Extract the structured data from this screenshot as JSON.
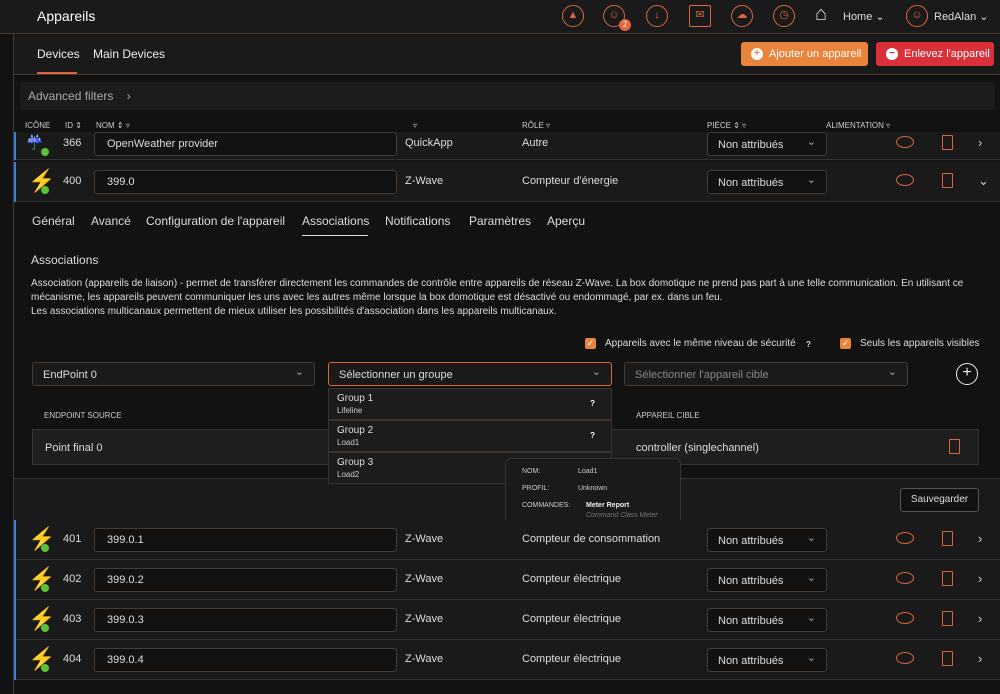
{
  "header": {
    "title": "Appareils",
    "home": "Home",
    "user": "RedAlan",
    "notification_count": "2",
    "icons": [
      "alarm-icon",
      "users-icon",
      "download-icon",
      "mail-icon",
      "weather-icon",
      "clock-icon",
      "home-icon",
      "user-icon"
    ]
  },
  "tabs": [
    {
      "label": "Devices",
      "active": true
    },
    {
      "label": "Main Devices"
    }
  ],
  "actions": {
    "add": "Ajouter un appareil",
    "remove": "Enlevez l'appareil",
    "add_color": "#e8843c",
    "remove_color": "#d9303a"
  },
  "filters": {
    "label": "Advanced filters"
  },
  "columns": {
    "icon": "ICÔNE",
    "id": "ID",
    "name": "NOM",
    "role": "RÔLE",
    "room": "PIÈCE",
    "power": "ALIMENTATION"
  },
  "rows": [
    {
      "id": "366",
      "name": "OpenWeather provider",
      "type": "QuickApp",
      "role": "Autre",
      "room": "Non attribués"
    },
    {
      "id": "400",
      "name": "399.0",
      "type": "Z-Wave",
      "role": "Compteur d'énergie",
      "room": "Non attribués"
    },
    {
      "id": "401",
      "name": "399.0.1",
      "type": "Z-Wave",
      "role": "Compteur de consommation",
      "room": "Non attribués"
    },
    {
      "id": "402",
      "name": "399.0.2",
      "type": "Z-Wave",
      "role": "Compteur électrique",
      "room": "Non attribués"
    },
    {
      "id": "403",
      "name": "399.0.3",
      "type": "Z-Wave",
      "role": "Compteur électrique",
      "room": "Non attribués"
    },
    {
      "id": "404",
      "name": "399.0.4",
      "type": "Z-Wave",
      "role": "Compteur électrique",
      "room": "Non attribués"
    }
  ],
  "detail": {
    "tabs": [
      "Général",
      "Avancé",
      "Configuration de l'appareil",
      "Associations",
      "Notifications",
      "Paramètres",
      "Aperçu"
    ],
    "active_tab": "Associations",
    "heading": "Associations",
    "desc1": "Association (appareils de liaison) - permet de transférer directement les commandes de contrôle entre appareils de réseau Z-Wave. La box domotique ne prend pas part à une telle communication. En utilisant ce",
    "desc2": "mécanisme, les appareils peuvent communiquer les uns avec les autres même lorsque la box domotique est désactivé ou endommagé, par ex. dans un feu.",
    "desc3": "Les associations multicanaux permettent de mieux utiliser les possibilités d'association dans les appareils multicanaux.",
    "check_security": "Appareils avec le même niveau de sécurité",
    "check_security_help": "?",
    "check_visible": "Seuls les appareils visibles",
    "endpoint": "EndPoint 0",
    "group_placeholder": "Sélectionner un groupe",
    "target_placeholder": "Sélectionner l'appareil cible",
    "col_source": "ENDPOINT SOURCE",
    "col_target": "APPAREIL CIBLE",
    "assoc_source": "Point final 0",
    "assoc_target": "controller (singlechannel)",
    "groups": [
      {
        "name": "Group 1",
        "label": "Lifeline"
      },
      {
        "name": "Group 2",
        "label": "Load1"
      },
      {
        "name": "Group 3",
        "label": "Load2"
      }
    ],
    "tooltip": {
      "k_name": "NOM:",
      "v_name": "Load1",
      "k_profile": "PROFIL:",
      "v_profile": "Unknown",
      "k_cmd": "COMMANDES:",
      "v_cmd": "Meter Report",
      "v_cmd_sub": "Command Class Meter"
    },
    "save": "Sauvegarder"
  }
}
